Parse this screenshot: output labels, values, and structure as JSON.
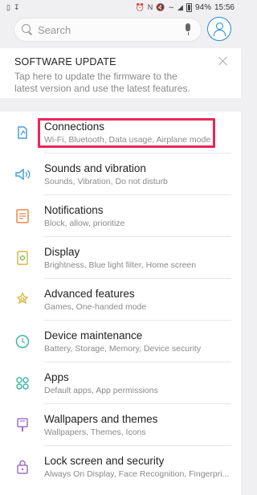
{
  "status_bar": {
    "left_icons": [
      "sim-card-icon",
      "download-icon"
    ],
    "right_icons": [
      "alarm-icon",
      "nfc-icon",
      "mute-icon",
      "wifi-icon",
      "signal-icon"
    ],
    "battery": "94%",
    "time": "15:56"
  },
  "search": {
    "placeholder": "Search",
    "icon": "search-icon",
    "mic_icon": "mic-icon",
    "account_icon": "account-icon"
  },
  "update_card": {
    "title": "SOFTWARE UPDATE",
    "text": "Tap here to update the firmware to the latest version and use the latest features."
  },
  "settings": [
    {
      "title": "Connections",
      "subtitle": "Wi-Fi, Bluetooth, Data usage, Airplane mode",
      "icon": "connections-icon",
      "highlighted": true
    },
    {
      "title": "Sounds and vibration",
      "subtitle": "Sounds, Vibration, Do not disturb",
      "icon": "sound-icon"
    },
    {
      "title": "Notifications",
      "subtitle": "Block, allow, prioritize",
      "icon": "notifications-icon"
    },
    {
      "title": "Display",
      "subtitle": "Brightness, Blue light filter, Home screen",
      "icon": "display-icon"
    },
    {
      "title": "Advanced features",
      "subtitle": "Games, One-handed mode",
      "icon": "advanced-features-icon"
    },
    {
      "title": "Device maintenance",
      "subtitle": "Battery, Storage, Memory, Device security",
      "icon": "device-maintenance-icon"
    },
    {
      "title": "Apps",
      "subtitle": "Default apps, App permissions",
      "icon": "apps-icon"
    },
    {
      "title": "Wallpapers and themes",
      "subtitle": "Wallpapers, Themes, Icons",
      "icon": "wallpapers-icon"
    },
    {
      "title": "Lock screen and security",
      "subtitle": "Always On Display, Face Recognition, Fingerpri...",
      "icon": "lock-icon"
    }
  ],
  "colors": {
    "highlight": "#e8265a",
    "accent": "#1a8bd6",
    "icon_blue": "#4a9fd8",
    "icon_orange": "#e88a4a",
    "icon_yellow": "#d6b84a",
    "icon_teal": "#3fb8a8",
    "icon_purple": "#a070c8"
  }
}
